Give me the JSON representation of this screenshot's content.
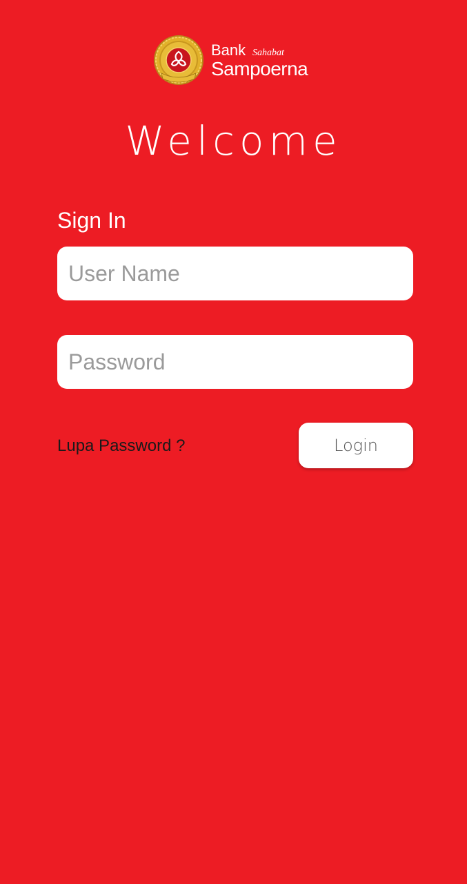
{
  "brand": {
    "line1": "Bank",
    "tagline": "Sahabat",
    "line2": "Sampoerna",
    "seal_top": "Bank",
    "seal_mid": "Sahabat",
    "seal_bottom": "Sampoerna",
    "colors": {
      "background": "#ED1C24",
      "seal_gold": "#D4A020",
      "seal_red": "#C8161D"
    }
  },
  "welcome": {
    "title": "Welcome"
  },
  "signin": {
    "label": "Sign In",
    "username": {
      "value": "",
      "placeholder": "User Name"
    },
    "password": {
      "value": "",
      "placeholder": "Password"
    },
    "forgot_link": "Lupa Password ?",
    "login_button": "Login"
  },
  "icons": {
    "logo": "bank-seal-icon"
  }
}
